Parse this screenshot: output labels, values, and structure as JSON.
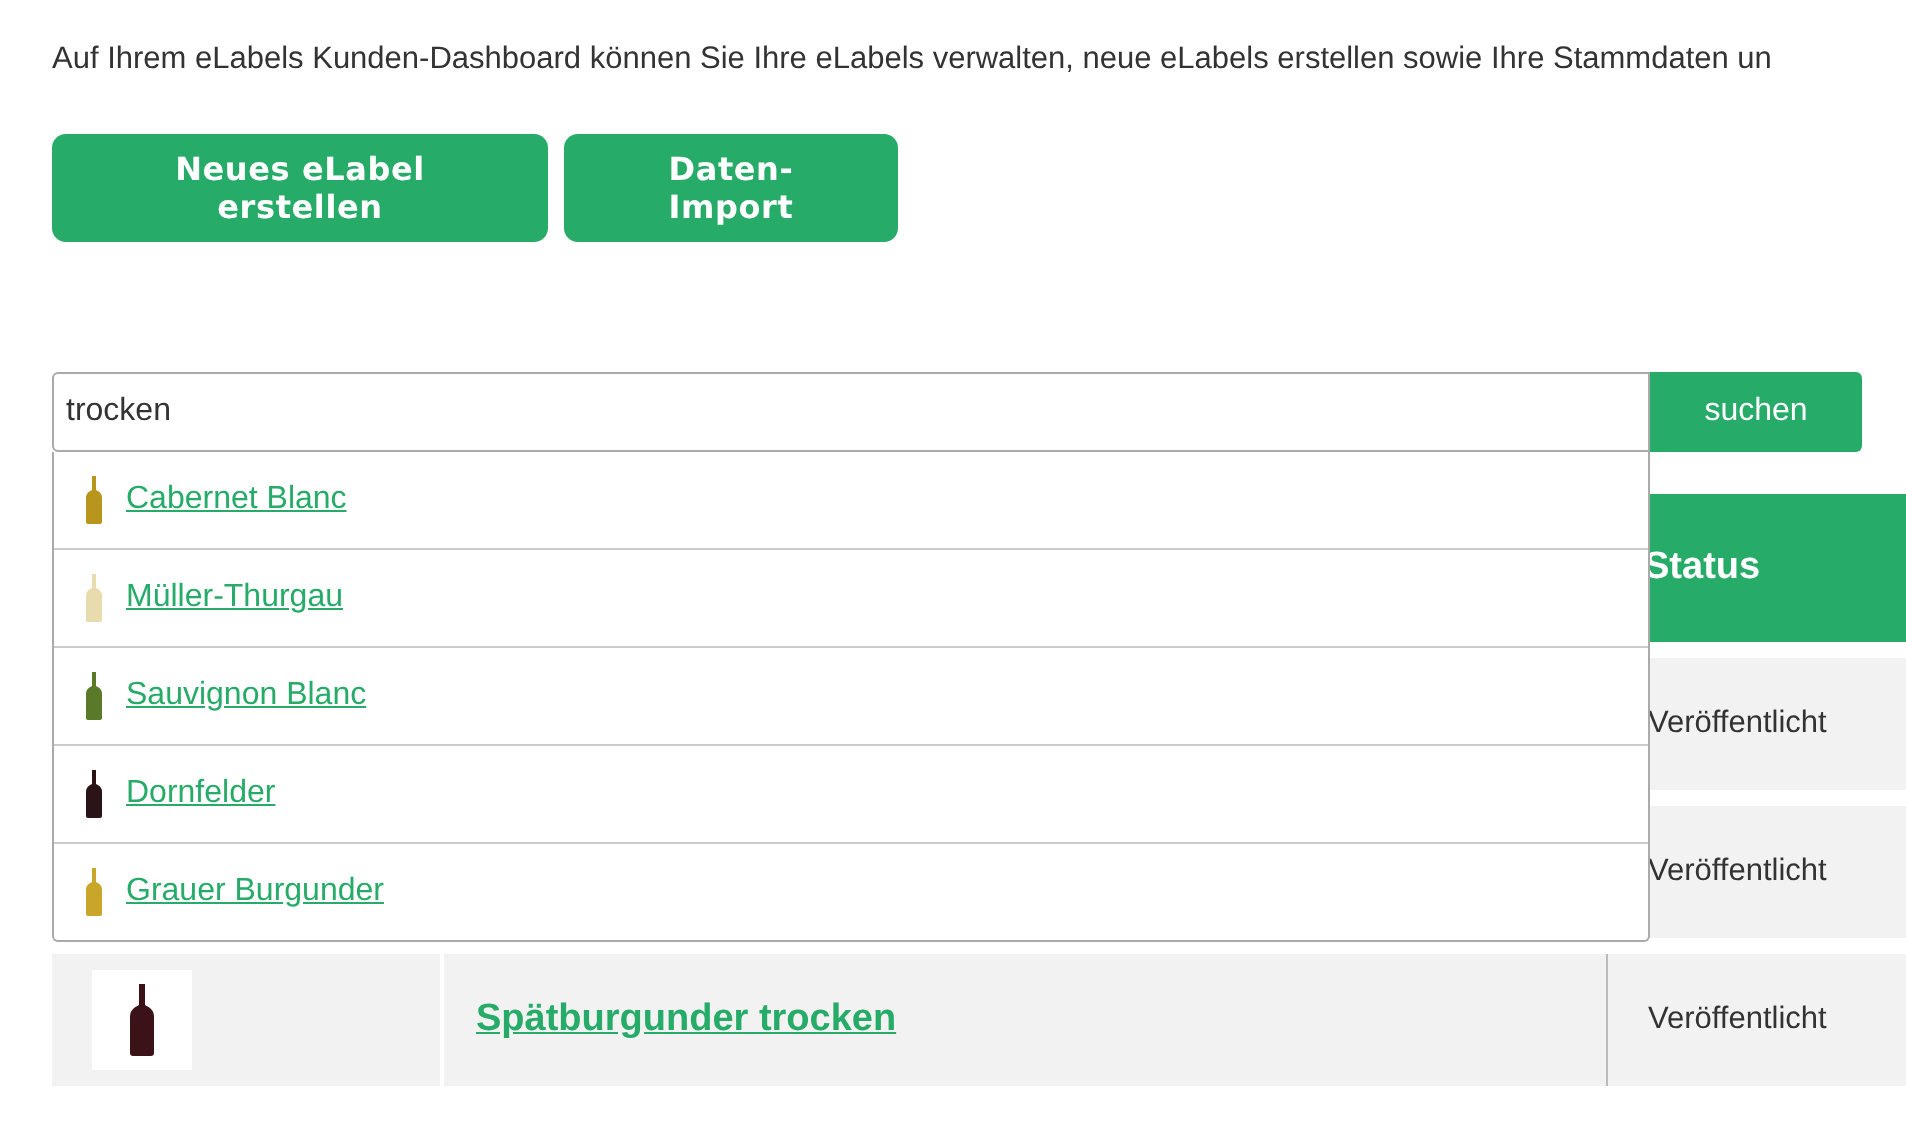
{
  "intro": "Auf Ihrem eLabels Kunden-Dashboard können Sie Ihre eLabels verwalten, neue eLabels erstellen sowie Ihre Stammdaten un",
  "actions": [
    "Neues eLabel erstellen",
    "Daten-Import"
  ],
  "search": {
    "value": "trocken",
    "button": "suchen"
  },
  "suggestions": [
    {
      "label": "Cabernet Blanc",
      "color": "#b8961e"
    },
    {
      "label": "Müller-Thurgau",
      "color": "#e8dcae"
    },
    {
      "label": "Sauvignon Blanc",
      "color": "#5a7a2a"
    },
    {
      "label": "Dornfelder",
      "color": "#2a1418"
    },
    {
      "label": "Grauer Burgunder",
      "color": "#c9a52a"
    }
  ],
  "table": {
    "columns": [
      "Status"
    ],
    "rows": [
      {
        "status": "Veröffentlicht"
      },
      {
        "status": "Veröffentlicht"
      },
      {
        "name": "Spätburgunder trocken",
        "status": "Veröffentlicht",
        "color": "#3a1218"
      }
    ]
  }
}
